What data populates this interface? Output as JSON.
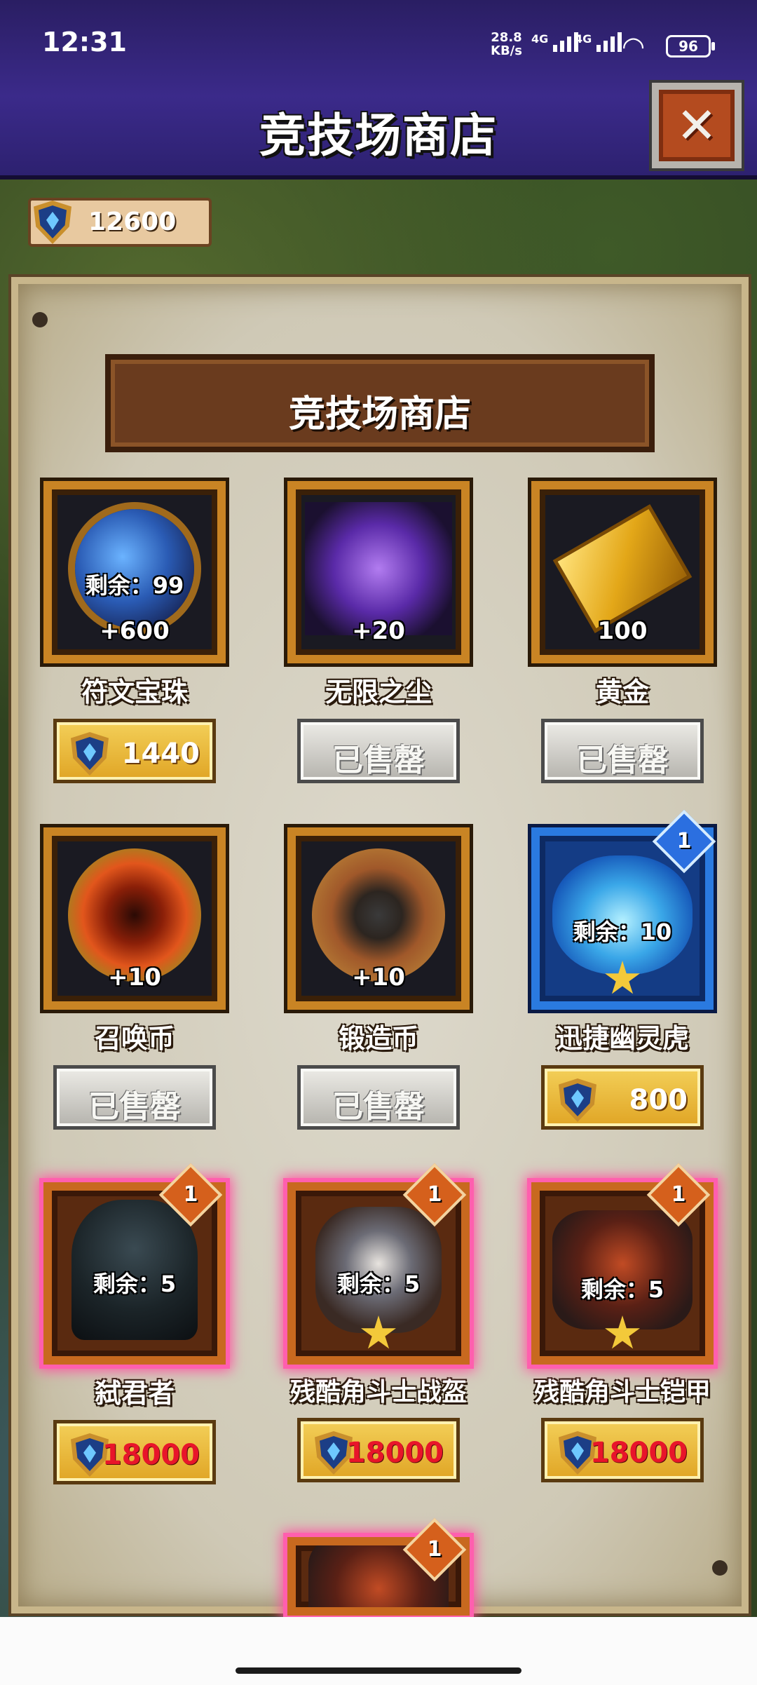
{
  "status_bar": {
    "time": "12:31",
    "net_speed": "28.8",
    "net_unit": "KB/s",
    "sim1": "4G",
    "sim2": "4G",
    "battery": "96"
  },
  "header": {
    "title": "竞技场商店",
    "close_icon": "close-x-icon"
  },
  "currency": {
    "icon": "arena-shield-gem-icon",
    "amount": "12600"
  },
  "banner": {
    "title": "竞技场商店"
  },
  "items": [
    {
      "name": "符文宝珠",
      "remain": "剩余：99",
      "amount": "+600",
      "button": {
        "type": "buy",
        "price": "1440"
      },
      "rarity": "normal"
    },
    {
      "name": "无限之尘",
      "amount": "+20",
      "button": {
        "type": "sold",
        "label": "已售罄"
      },
      "rarity": "normal"
    },
    {
      "name": "黄金",
      "amount": "100",
      "button": {
        "type": "sold",
        "label": "已售罄"
      },
      "rarity": "normal"
    },
    {
      "name": "召唤币",
      "amount": "+10",
      "button": {
        "type": "sold",
        "label": "已售罄"
      },
      "rarity": "normal"
    },
    {
      "name": "锻造币",
      "amount": "+10",
      "button": {
        "type": "sold",
        "label": "已售罄"
      },
      "rarity": "normal"
    },
    {
      "name": "迅捷幽灵虎",
      "remain": "剩余：10",
      "badge": "1",
      "stars": 1,
      "button": {
        "type": "buy",
        "price": "800"
      },
      "rarity": "blue"
    },
    {
      "name": "弑君者",
      "remain": "剩余：5",
      "badge": "1",
      "button": {
        "type": "buy",
        "price": "18000"
      },
      "rarity": "epic"
    },
    {
      "name": "残酷角斗士战盔",
      "remain": "剩余：5",
      "badge": "1",
      "stars": 1,
      "button": {
        "type": "buy",
        "price": "18000"
      },
      "rarity": "epic"
    },
    {
      "name": "残酷角斗士铠甲",
      "remain": "剩余：5",
      "badge": "1",
      "stars": 1,
      "button": {
        "type": "buy",
        "price": "18000"
      },
      "rarity": "epic"
    },
    {
      "badge": "1",
      "rarity": "epic"
    }
  ],
  "colors": {
    "header_bg": "#3b2a8a",
    "gold_button": "#e8b43a",
    "sold_button": "#c9c8c3",
    "price_red": "#e8152a",
    "epic_glow": "#ff4fa0"
  }
}
